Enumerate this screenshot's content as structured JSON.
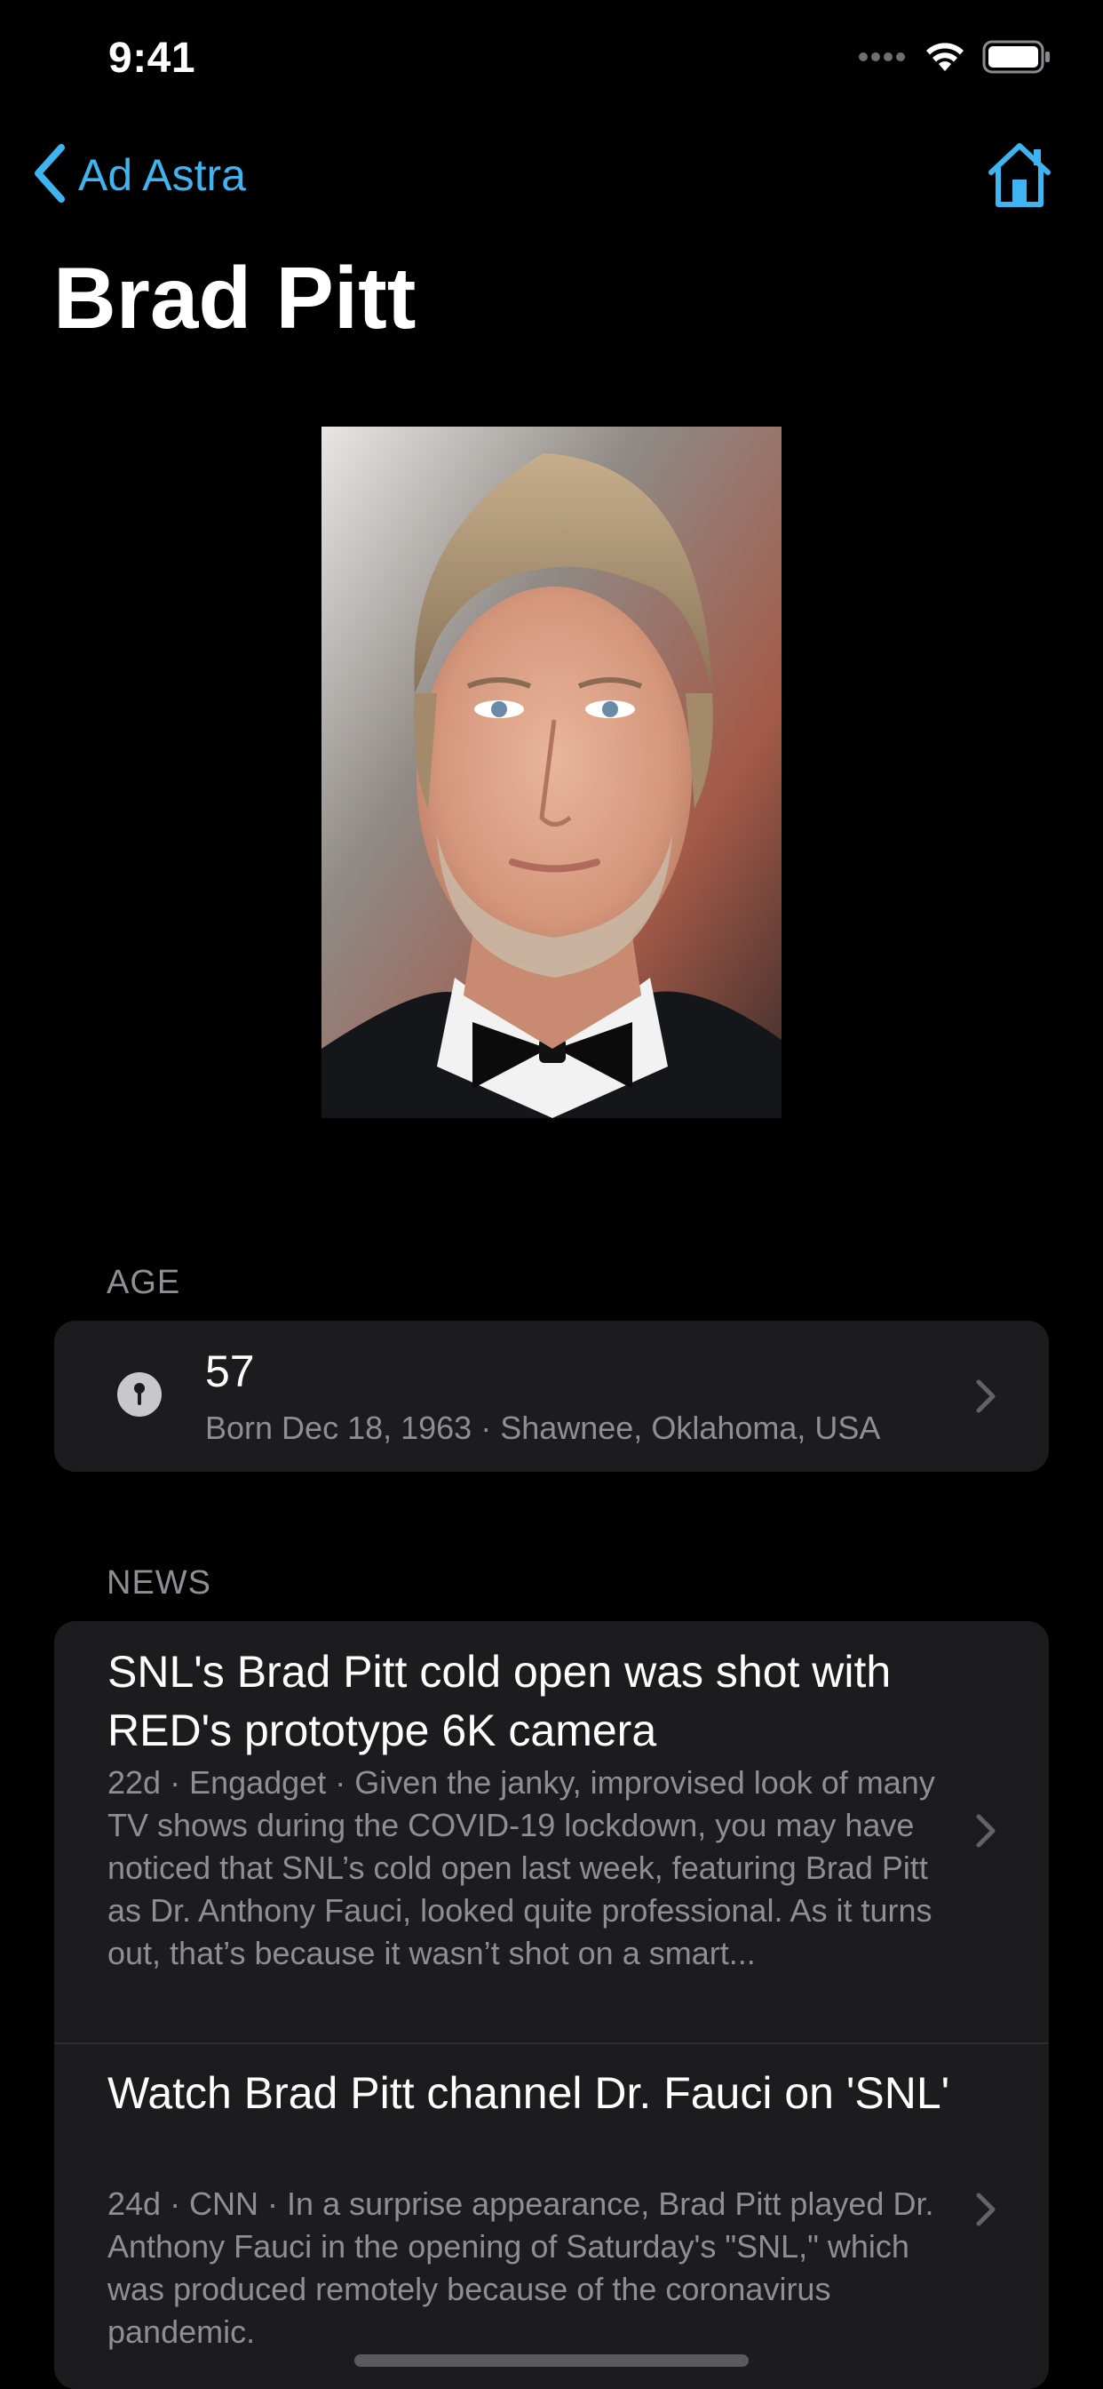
{
  "status_bar": {
    "time": "9:41",
    "icons": [
      "signal-dots-icon",
      "wifi-icon",
      "battery-icon"
    ]
  },
  "nav": {
    "back_label": "Ad Astra",
    "back_icon": "chevron-left-icon",
    "home_icon": "house-icon",
    "accent_color": "#3eb4f0"
  },
  "page": {
    "title": "Brad Pitt",
    "portrait_alt": "Brad Pitt portrait photo"
  },
  "age_section": {
    "header": "AGE",
    "value": "57",
    "detail": "Born Dec 18, 1963 · Shawnee, Oklahoma, USA",
    "icon": "pin-icon"
  },
  "news_section": {
    "header": "NEWS",
    "items": [
      {
        "title": "SNL's Brad Pitt cold open was shot with RED's prototype 6K camera",
        "body": "22d · Engadget · Given the janky, improvised look of many TV shows during the COVID-19 lockdown, you may have noticed that SNL’s cold open last week, featuring Brad Pitt as Dr. Anthony Fauci, looked quite professional. As it turns out, that’s because it wasn’t shot on a smart..."
      },
      {
        "title": "Watch Brad Pitt channel Dr. Fauci on 'SNL'",
        "body": "24d · CNN · In a surprise appearance, Brad Pitt played Dr. Anthony Fauci in the opening of Saturday's \"SNL,\" which was produced remotely because of the coronavirus pandemic."
      }
    ]
  }
}
